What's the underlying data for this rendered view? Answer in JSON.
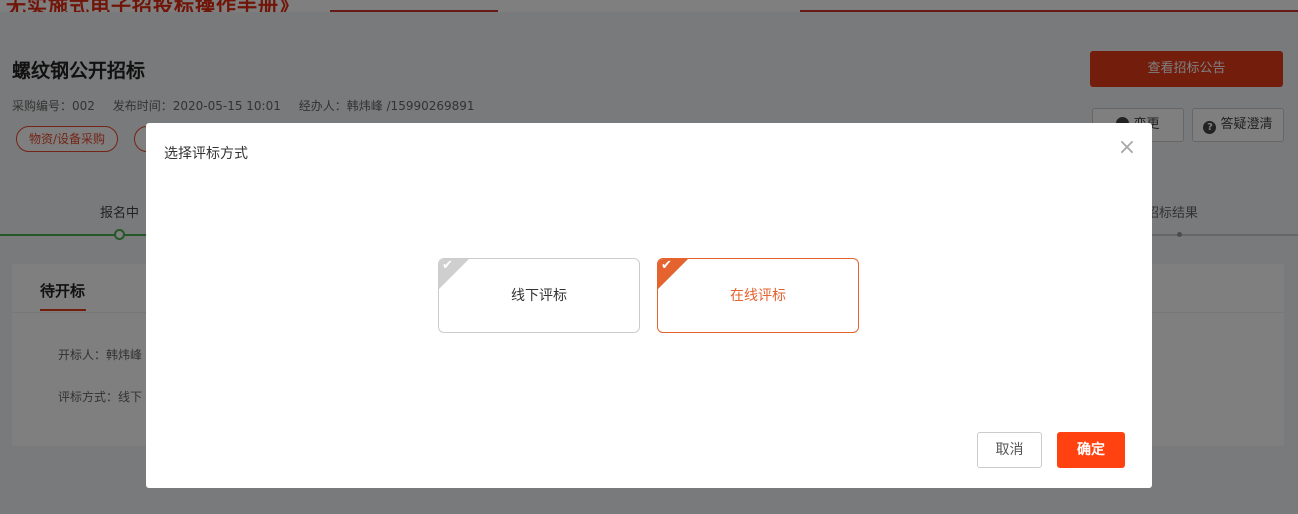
{
  "banner": {
    "text": "无实施式电子招投标操作手册》"
  },
  "project": {
    "title": "螺纹钢公开招标",
    "meta": {
      "purchase_no": "采购编号：002",
      "publish_time": "发布时间：2020-05-15 10:01",
      "handler": "经办人：韩炜峰 /15990269891"
    },
    "tags": [
      "物资/设备采购"
    ]
  },
  "actions": {
    "view_notice": "查看招标公告",
    "change": "变更",
    "qa": "答疑澄清"
  },
  "progress": {
    "first_step": "报名中",
    "last_step": "招标结果"
  },
  "card": {
    "tab": "待开标",
    "rows": [
      {
        "label": "开标人：韩炜峰"
      },
      {
        "label": "评标方式：线下"
      }
    ]
  },
  "modal": {
    "title": "选择评标方式",
    "close_icon": "×",
    "options": [
      {
        "label": "线下评标",
        "selected": false,
        "check": "✔"
      },
      {
        "label": "在线评标",
        "selected": true,
        "check": "✔"
      }
    ],
    "cancel_label": "取消",
    "confirm_label": "确定"
  },
  "colors": {
    "accent": "#e63a1a",
    "selected_border": "#e4632e",
    "confirm_button": "#ff4210",
    "progress_done": "#4caf50",
    "overlay": "rgba(0,0,0,0.5)"
  }
}
